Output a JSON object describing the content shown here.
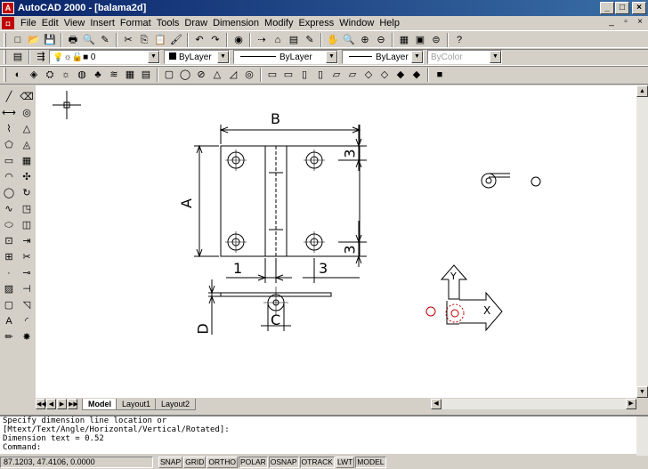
{
  "window": {
    "title": "AutoCAD 2000 - [balama2d]",
    "app_icon": "A",
    "minimize": "_",
    "maximize": "□",
    "close": "×"
  },
  "menu": {
    "items": [
      "File",
      "Edit",
      "View",
      "Insert",
      "Format",
      "Tools",
      "Draw",
      "Dimension",
      "Modify",
      "Express",
      "Window",
      "Help"
    ],
    "doc_min": "_",
    "doc_restore": "▫",
    "doc_close": "×"
  },
  "standard_toolbar": {
    "icons": [
      "new-icon",
      "open-icon",
      "save-icon",
      "print-icon",
      "print-preview-icon",
      "plot-icon",
      "cut-icon",
      "copy-icon",
      "paste-icon",
      "match-properties-icon",
      "undo-icon",
      "redo-icon",
      "3d-orbit-icon",
      "snap-icon",
      "block-icon",
      "insert-icon",
      "redline-icon",
      "pan-icon",
      "zoom-realtime-icon",
      "zoom-window-icon",
      "zoom-previous-icon",
      "properties-icon",
      "design-center-icon",
      "dbconnect-icon",
      "help-icon"
    ],
    "glyphs": [
      "□",
      "📂",
      "💾",
      "🖶",
      "🔍",
      "✎",
      "✂",
      "⎘",
      "📋",
      "🖌",
      "↶",
      "↷",
      "◉",
      "⇢",
      "⌂",
      "▤",
      "✎",
      "✋",
      "🔍",
      "⊕",
      "⊖",
      "▦",
      "▣",
      "⊜",
      "?"
    ]
  },
  "layer_toolbar": {
    "layer_value": "0",
    "color_value": "ByLayer",
    "linetype_value": "ByLayer",
    "lineweight_value": "ByLayer",
    "plotstyle_value": "ByColor"
  },
  "render_toolbar": {
    "icons": [
      "hide-icon",
      "render-icon",
      "scene-icon",
      "light-icon",
      "material-icon",
      "landscape-icon",
      "fog-icon",
      "mapping-icon",
      "statistics-icon",
      "solid-box-icon",
      "solid-sphere-icon",
      "solid-cylinder-icon",
      "solid-cone-icon",
      "solid-wedge-icon",
      "solid-torus-icon",
      "view-top-icon",
      "view-bottom-icon",
      "view-left-icon",
      "view-right-icon",
      "view-front-icon",
      "view-back-icon",
      "view-sw-iso-icon",
      "view-se-iso-icon",
      "view-ne-iso-icon",
      "view-nw-iso-icon",
      "shade-icon"
    ],
    "glyphs": [
      "◐",
      "◈",
      "⛭",
      "☼",
      "◍",
      "♣",
      "≋",
      "▦",
      "▤",
      "▢",
      "◯",
      "⊘",
      "△",
      "◿",
      "◎",
      "▭",
      "▭",
      "▯",
      "▯",
      "▱",
      "▱",
      "◇",
      "◇",
      "◆",
      "◆",
      "■"
    ]
  },
  "draw_toolbar": {
    "icons": [
      "line-icon",
      "xline-icon",
      "polyline-icon",
      "polygon-icon",
      "rectangle-icon",
      "arc-icon",
      "circle-icon",
      "spline-icon",
      "ellipse-icon",
      "insert-block-icon",
      "make-block-icon",
      "point-icon",
      "hatch-icon",
      "region-icon",
      "mtext-icon",
      "pencil-icon"
    ],
    "glyphs": [
      "╱",
      "⟷",
      "⌇",
      "⬠",
      "▭",
      "◠",
      "◯",
      "∿",
      "⬭",
      "⊡",
      "⊞",
      "·",
      "▨",
      "▢",
      "A",
      "✏"
    ]
  },
  "modify_toolbar": {
    "icons": [
      "erase-icon",
      "copy-object-icon",
      "mirror-icon",
      "offset-icon",
      "array-icon",
      "move-icon",
      "rotate-icon",
      "scale-icon",
      "stretch-icon",
      "lengthen-icon",
      "trim-icon",
      "extend-icon",
      "break-icon",
      "chamfer-icon",
      "fillet-icon",
      "explode-icon"
    ],
    "glyphs": [
      "⌫",
      "◎",
      "△",
      "◬",
      "▦",
      "✣",
      "↻",
      "◳",
      "◫",
      "⇥",
      "✂",
      "⊸",
      "⊣",
      "◹",
      "◜",
      "✸"
    ]
  },
  "layout_tabs": {
    "items": [
      "Model",
      "Layout1",
      "Layout2"
    ]
  },
  "drawing_labels": {
    "b": "B",
    "a": "A",
    "three_top": "3",
    "three_bottom": "3",
    "one": "1",
    "three_lower": "3",
    "c": "C",
    "d": "D",
    "ucs_x": "X",
    "ucs_y": "Y"
  },
  "command_line": {
    "lines": [
      "Specify dimension line location or",
      "[Mtext/Text/Angle/Horizontal/Vertical/Rotated]:",
      "Dimension text = 0.52",
      "Command:"
    ]
  },
  "status_bar": {
    "coordinates": "87.1203, 47.4106, 0.0000",
    "toggles": [
      "SNAP",
      "GRID",
      "ORTHO",
      "POLAR",
      "OSNAP",
      "OTRACK",
      "LWT",
      "MODEL"
    ],
    "toggles_on": [
      false,
      false,
      false,
      true,
      true,
      true,
      false,
      true
    ]
  }
}
